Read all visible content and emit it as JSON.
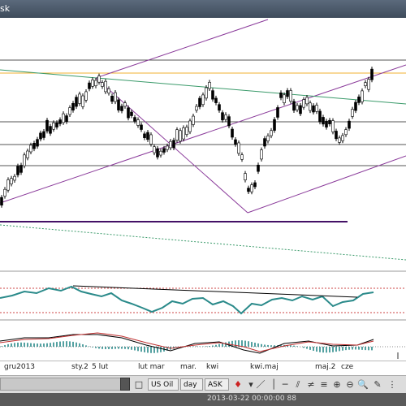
{
  "window": {
    "title": "sk"
  },
  "xaxis": {
    "labels": [
      "gru2013",
      "sty.2",
      "5 lut",
      "lut mar",
      "mar.",
      "kwi",
      "kwi.maj",
      "maj.2",
      "cze"
    ]
  },
  "toolbar": {
    "instrument": "US Oil",
    "period": "day",
    "price_type": "ASK"
  },
  "status": {
    "datetime": "2013-03-22 00:00:00",
    "value": "88"
  },
  "colors": {
    "candle": "#000000",
    "trend_channel": "#8a3a9a",
    "diagonal_trend": "#3a9a6a",
    "horizontal_level": "#f0b030",
    "oscillator": "#2a8a8a",
    "macd_signal": "#c03030",
    "macd_hist": "#2a8a8a"
  },
  "chart_data": {
    "type": "candlestick",
    "x_labels": [
      "gru2013",
      "sty.2",
      "5 lut",
      "lut mar",
      "mar.",
      "kwi",
      "kwi.maj",
      "maj.2",
      "cze"
    ],
    "instrument": "US Oil",
    "period": "day",
    "price_type": "ASK"
  }
}
